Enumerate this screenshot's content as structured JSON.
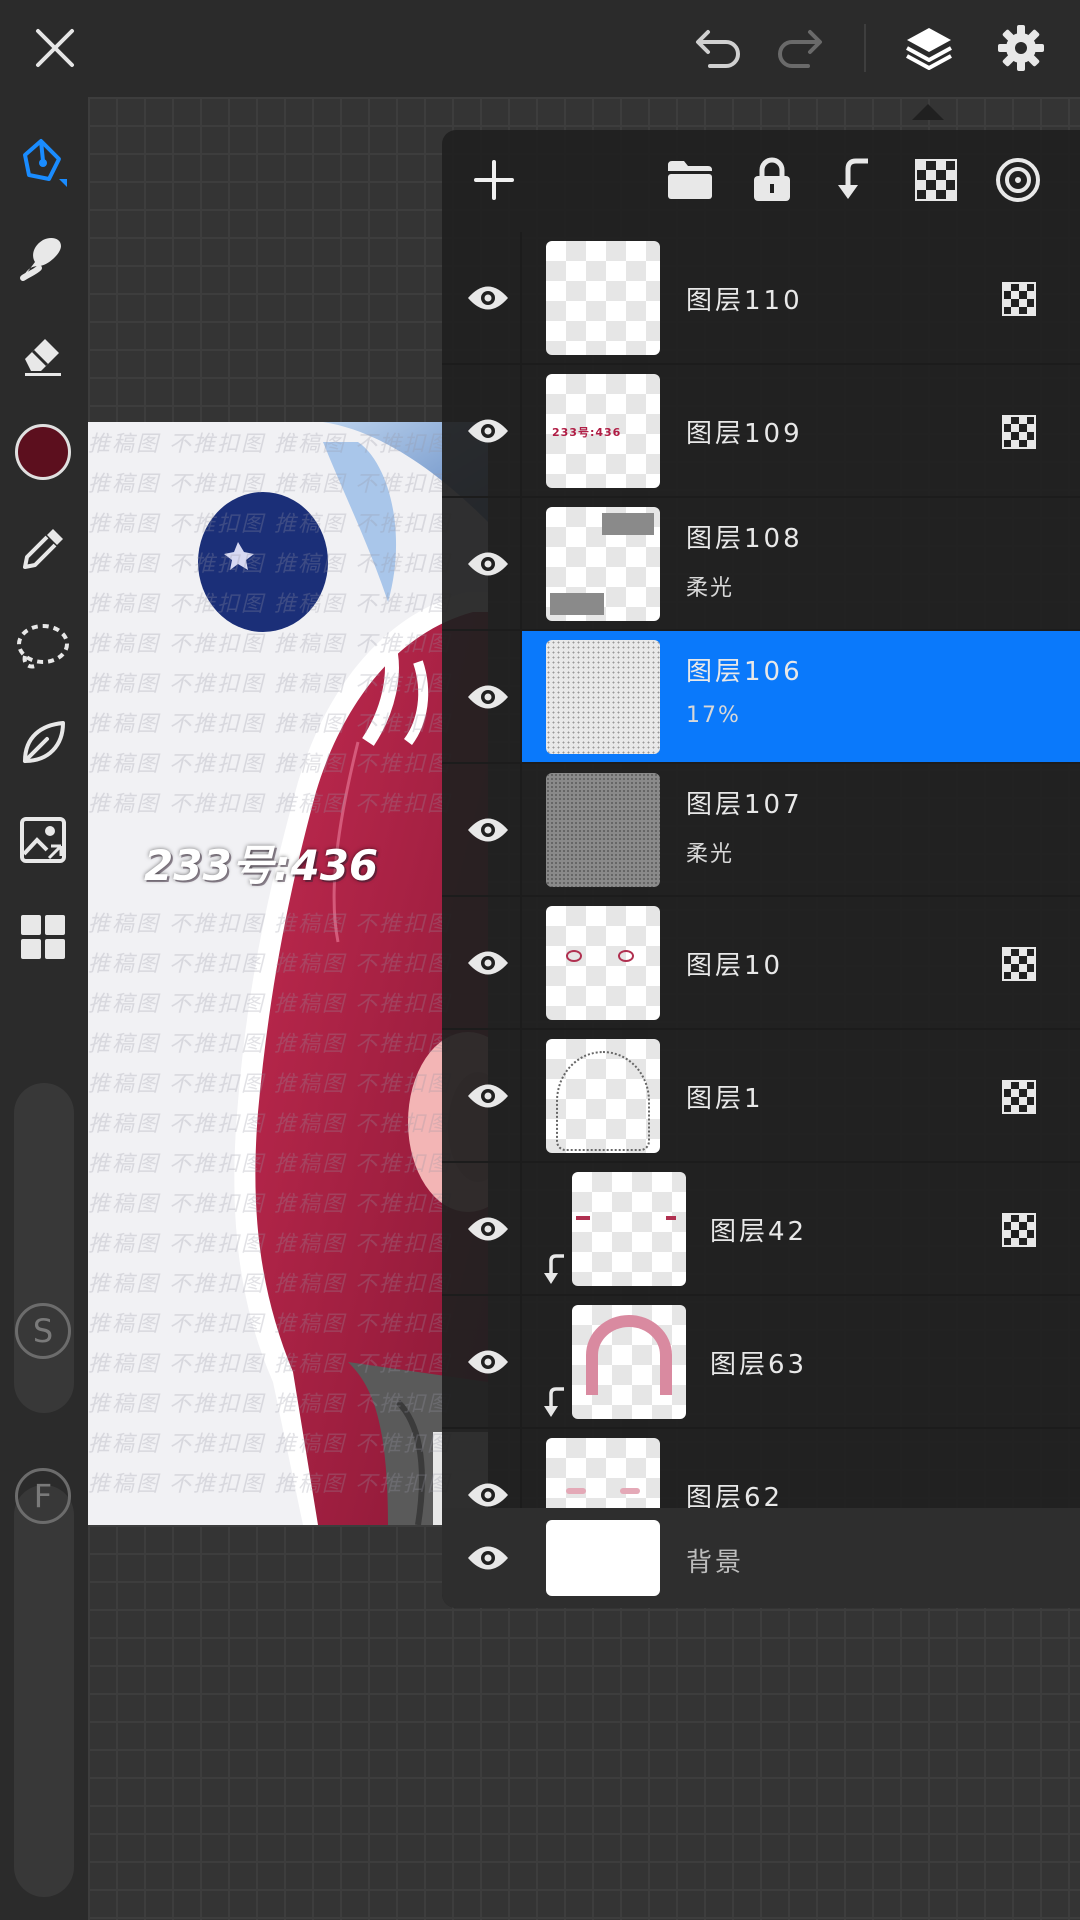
{
  "topbar": {
    "close_icon": "close-icon",
    "undo_icon": "undo-icon",
    "redo_icon": "redo-icon",
    "layers_icon": "layers-icon",
    "settings_icon": "gear-icon"
  },
  "toolbar": {
    "tools": [
      "pen",
      "smudge",
      "eraser",
      "color",
      "eyedropper",
      "lasso",
      "leaf",
      "image-transform",
      "gallery"
    ],
    "current_color": "#5c0f1e",
    "accent": "#1a8cff",
    "size_label": "S",
    "opacity_label": "F"
  },
  "artwork": {
    "id_text": "233号:436",
    "watermark_text": "推稿图 不推扣图 推稿图 不推扣图"
  },
  "panel": {
    "tools": [
      "add-layer",
      "folder",
      "lock",
      "clip",
      "alpha-lock",
      "blend"
    ],
    "layers": [
      {
        "name": "图层110",
        "mode": "",
        "alpha_lock": true,
        "clipped": false,
        "selected": false
      },
      {
        "name": "图层109",
        "mode": "",
        "alpha_lock": true,
        "clipped": false,
        "selected": false
      },
      {
        "name": "图层108",
        "mode": "柔光",
        "alpha_lock": false,
        "clipped": false,
        "selected": false
      },
      {
        "name": "图层106",
        "mode": "17%",
        "alpha_lock": false,
        "clipped": false,
        "selected": true
      },
      {
        "name": "图层107",
        "mode": "柔光",
        "alpha_lock": false,
        "clipped": false,
        "selected": false
      },
      {
        "name": "图层10",
        "mode": "",
        "alpha_lock": true,
        "clipped": false,
        "selected": false
      },
      {
        "name": "图层1",
        "mode": "",
        "alpha_lock": true,
        "clipped": false,
        "selected": false
      },
      {
        "name": "图层42",
        "mode": "",
        "alpha_lock": true,
        "clipped": true,
        "selected": false
      },
      {
        "name": "图层63",
        "mode": "",
        "alpha_lock": false,
        "clipped": true,
        "selected": false
      },
      {
        "name": "图层62",
        "mode": "",
        "alpha_lock": false,
        "clipped": false,
        "selected": false
      }
    ],
    "background_label": "背景",
    "selected_color": "#0a79fb"
  }
}
